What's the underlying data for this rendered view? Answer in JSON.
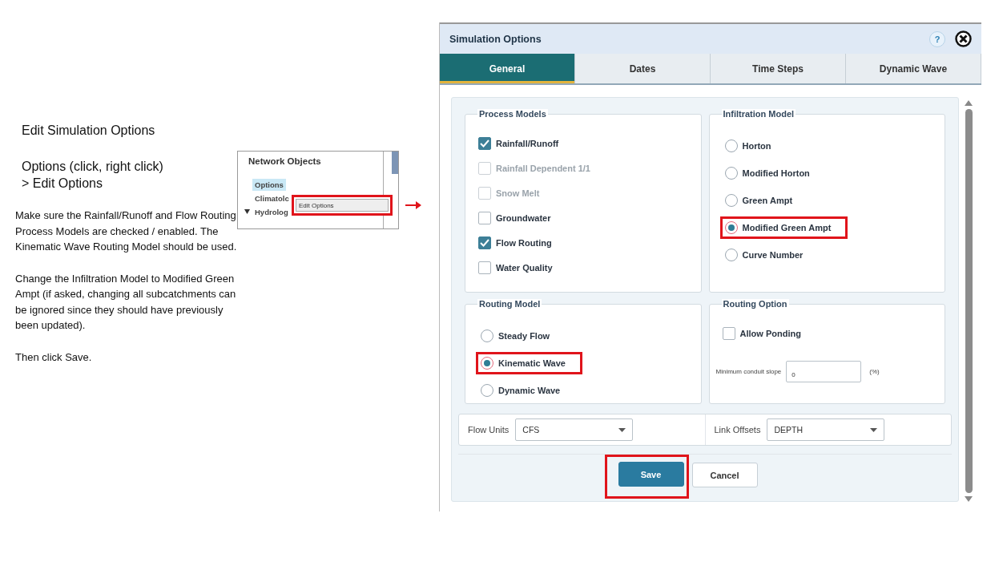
{
  "instructions": {
    "heading": "Edit  Simulation Options",
    "steps": [
      "Options (click, right click)",
      "> Edit Options"
    ],
    "paragraphs": [
      "Make sure the Rainfall/Runoff and Flow Routing Process Models are checked / enabled. The Kinematic Wave Routing Model should be used.",
      "Change the Infiltration Model to Modified Green Ampt (if asked, changing all subcatchments can be ignored since they should have previously been updated).",
      "Then click Save."
    ]
  },
  "network_objects": {
    "title": "Network Objects",
    "items": [
      {
        "label": "Options",
        "selected": true,
        "kind": "leaf"
      },
      {
        "label": "Climatolc",
        "selected": false,
        "kind": "leaf"
      },
      {
        "label": "Hydrolog",
        "selected": false,
        "kind": "group",
        "expanded": true
      }
    ],
    "context_menu": {
      "items": [
        {
          "label": "Edit Options",
          "highlighted": true
        }
      ]
    }
  },
  "dialog": {
    "title": "Simulation Options",
    "help": "?",
    "tabs": [
      {
        "label": "General",
        "selected": true
      },
      {
        "label": "Dates",
        "selected": false
      },
      {
        "label": "Time Steps",
        "selected": false
      },
      {
        "label": "Dynamic Wave",
        "selected": false
      }
    ],
    "process_models": {
      "title": "Process Models",
      "items": [
        {
          "label": "Rainfall/Runoff",
          "checked": true,
          "disabled": false
        },
        {
          "label": "Rainfall Dependent 1/1",
          "checked": false,
          "disabled": true
        },
        {
          "label": "Snow Melt",
          "checked": false,
          "disabled": true
        },
        {
          "label": "Groundwater",
          "checked": false,
          "disabled": false
        },
        {
          "label": "Flow Routing",
          "checked": true,
          "disabled": false
        },
        {
          "label": "Water Quality",
          "checked": false,
          "disabled": false
        }
      ]
    },
    "infiltration_model": {
      "title": "Infiltration Model",
      "options": [
        {
          "label": "Horton",
          "selected": false,
          "highlighted": false
        },
        {
          "label": "Modified Horton",
          "selected": false,
          "highlighted": false
        },
        {
          "label": "Green Ampt",
          "selected": false,
          "highlighted": false
        },
        {
          "label": "Modified Green Ampt",
          "selected": true,
          "highlighted": true
        },
        {
          "label": "Curve Number",
          "selected": false,
          "highlighted": false
        }
      ]
    },
    "routing_model": {
      "title": "Routing Model",
      "options": [
        {
          "label": "Steady Flow",
          "selected": false,
          "highlighted": false
        },
        {
          "label": "Kinematic Wave",
          "selected": true,
          "highlighted": true
        },
        {
          "label": "Dynamic Wave",
          "selected": false,
          "highlighted": false
        }
      ]
    },
    "routing_option": {
      "title": "Routing Option",
      "allow_ponding": {
        "label": "Allow Ponding",
        "checked": false
      },
      "min_slope": {
        "label": "Minimum conduit slope",
        "value": "0",
        "unit": "(%)"
      }
    },
    "flow_units": {
      "label": "Flow Units",
      "value": "CFS"
    },
    "link_offsets": {
      "label": "Link Offsets",
      "value": "DEPTH"
    },
    "buttons": [
      {
        "label": "Save",
        "kind": "primary",
        "highlighted": true
      },
      {
        "label": "Cancel",
        "kind": "secondary",
        "highlighted": false
      }
    ]
  }
}
